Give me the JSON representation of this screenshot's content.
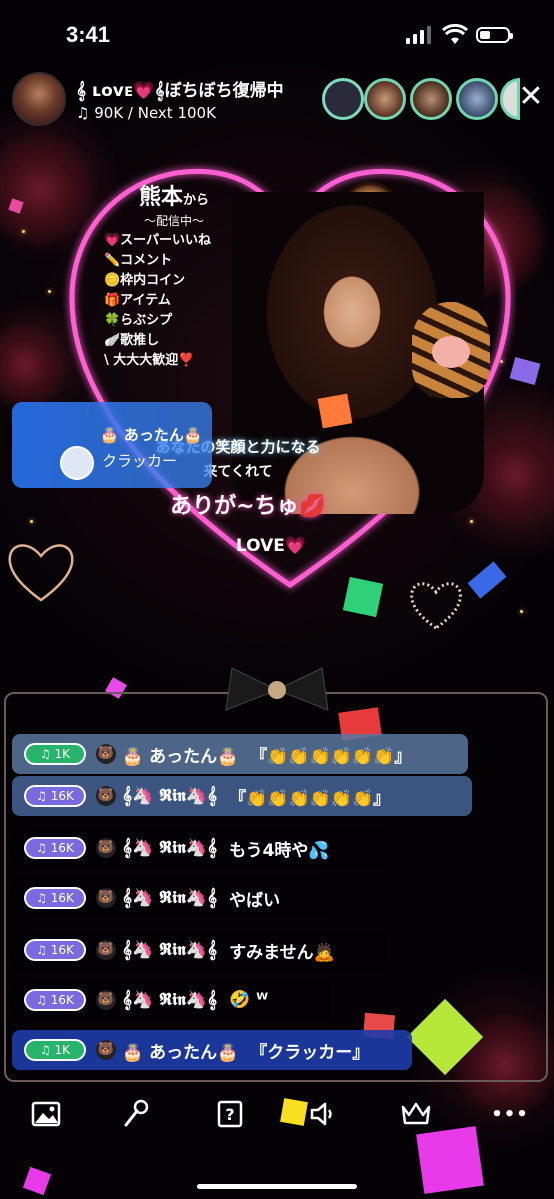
{
  "status_bar": {
    "time": "3:41"
  },
  "header": {
    "title": "𝄞 ʟᴏᴠᴇ💗𝄞ぼちぼち復帰中",
    "music_icon": "♫",
    "points": "90K / Next 100K",
    "close_label": "✕"
  },
  "poster": {
    "location": "熊本",
    "kara": "から",
    "broadcasting": "～配信中～",
    "menu": [
      "💗スーパーいいね",
      "✏️コメント",
      "🪙枠内コイン",
      "🎁アイテム",
      "🍀らぶシプ",
      "🪽歌推し",
      "\\ 大大大歓迎❣️"
    ],
    "support_line": "あなたの笑顔と力になる",
    "come_line": "来てくれて",
    "thanks": "ありが~ちゅ💋",
    "love": "LOVE💗"
  },
  "gift_toast": {
    "user": "🎂 あったん🎂",
    "gift": "クラッカー"
  },
  "chat": [
    {
      "level": "1K",
      "level_color": "#27b36a",
      "bg": "rgba(90,120,160,0.85)",
      "name": "🎂 あったん🎂",
      "message": "『👏👏👏👏👏👏』"
    },
    {
      "level": "16K",
      "level_color": "#7a6ae0",
      "bg": "rgba(70,100,150,0.85)",
      "name": "𝄞🦄 𝕽𝖎𝖓🦄𝄞",
      "message": "『👏👏👏👏👏👏』"
    },
    {
      "level": "16K",
      "level_color": "#7a6ae0",
      "bg": "rgba(0,0,0,0.35)",
      "name": "𝄞🦄 𝕽𝖎𝖓🦄𝄞",
      "message": "もう4時や💦"
    },
    {
      "level": "16K",
      "level_color": "#7a6ae0",
      "bg": "rgba(0,0,0,0.35)",
      "name": "𝄞🦄 𝕽𝖎𝖓🦄𝄞",
      "message": "やばい"
    },
    {
      "level": "16K",
      "level_color": "#7a6ae0",
      "bg": "rgba(0,0,0,0.35)",
      "name": "𝄞🦄 𝕽𝖎𝖓🦄𝄞",
      "message": "すみません🙇"
    },
    {
      "level": "16K",
      "level_color": "#7a6ae0",
      "bg": "rgba(0,0,0,0.35)",
      "name": "𝄞🦄 𝕽𝖎𝖓🦄𝄞",
      "message": "🤣 ᵂ"
    },
    {
      "level": "1K",
      "level_color": "#27b36a",
      "bg": "rgba(30,60,170,0.9)",
      "name": "🎂 あったん🎂",
      "message": "『クラッカー』"
    }
  ],
  "toolbar": [
    {
      "name": "image-icon",
      "glyph": "🖼"
    },
    {
      "name": "microphone-icon",
      "glyph": "🎤"
    },
    {
      "name": "question-icon",
      "glyph": "?"
    },
    {
      "name": "speaker-icon",
      "glyph": "🔈"
    },
    {
      "name": "crown-icon",
      "glyph": "♛"
    },
    {
      "name": "more-icon",
      "glyph": "•••"
    }
  ]
}
